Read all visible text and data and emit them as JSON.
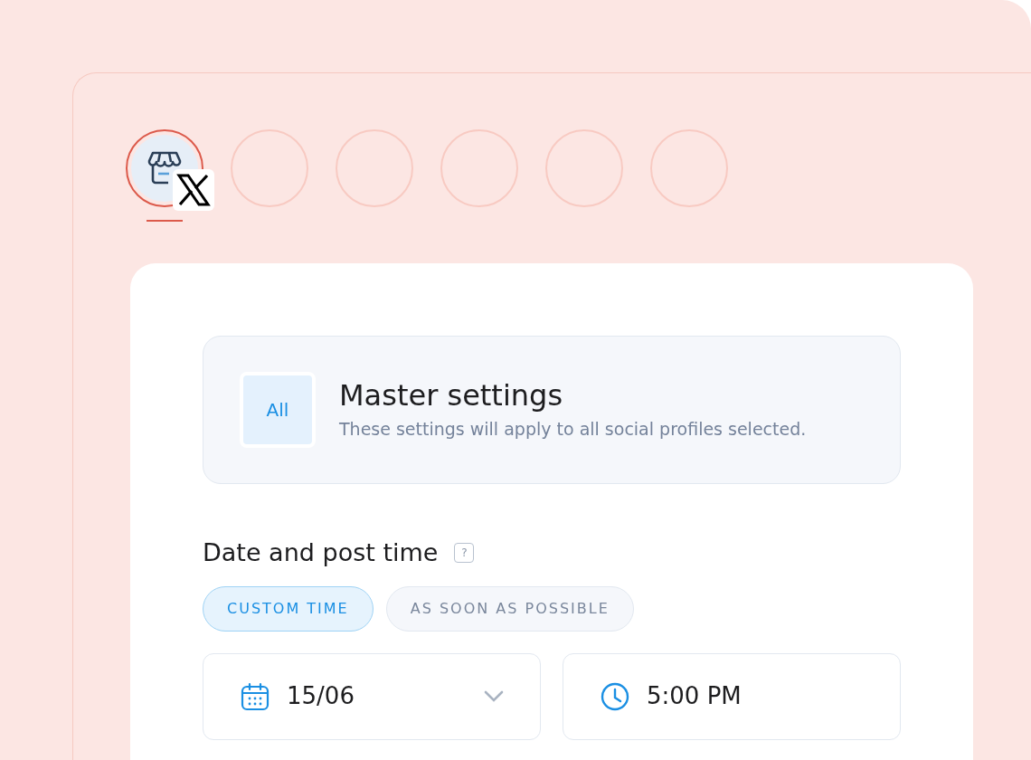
{
  "profiles": [
    {
      "kind": "account",
      "selected": true
    },
    {
      "kind": "empty",
      "selected": false
    },
    {
      "kind": "empty",
      "selected": false
    },
    {
      "kind": "empty",
      "selected": false
    },
    {
      "kind": "empty",
      "selected": false
    },
    {
      "kind": "empty",
      "selected": false
    }
  ],
  "master": {
    "badge": "All",
    "title": "Master settings",
    "subtitle": "These settings will apply to all social profiles selected."
  },
  "date_section": {
    "heading": "Date and post time",
    "help": "?",
    "options": [
      {
        "label": "CUSTOM TIME",
        "selected": true
      },
      {
        "label": "AS SOON AS POSSIBLE",
        "selected": false
      }
    ],
    "date": {
      "value": "15/06"
    },
    "time": {
      "value": "5:00 PM"
    }
  }
}
